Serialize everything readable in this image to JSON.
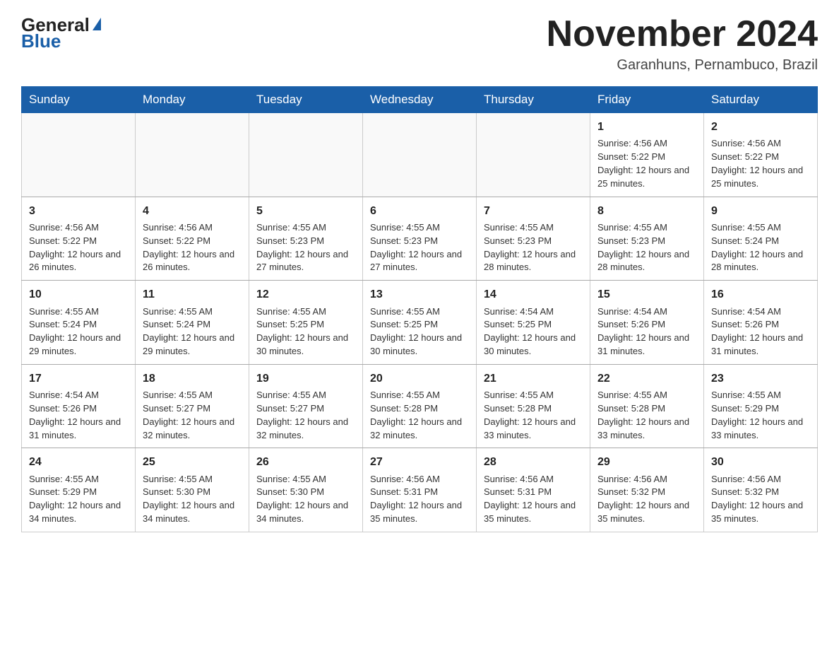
{
  "header": {
    "logo_general": "General",
    "logo_blue": "Blue",
    "month_title": "November 2024",
    "subtitle": "Garanhuns, Pernambuco, Brazil"
  },
  "days_of_week": [
    "Sunday",
    "Monday",
    "Tuesday",
    "Wednesday",
    "Thursday",
    "Friday",
    "Saturday"
  ],
  "weeks": [
    [
      {
        "day": "",
        "info": ""
      },
      {
        "day": "",
        "info": ""
      },
      {
        "day": "",
        "info": ""
      },
      {
        "day": "",
        "info": ""
      },
      {
        "day": "",
        "info": ""
      },
      {
        "day": "1",
        "info": "Sunrise: 4:56 AM\nSunset: 5:22 PM\nDaylight: 12 hours and 25 minutes."
      },
      {
        "day": "2",
        "info": "Sunrise: 4:56 AM\nSunset: 5:22 PM\nDaylight: 12 hours and 25 minutes."
      }
    ],
    [
      {
        "day": "3",
        "info": "Sunrise: 4:56 AM\nSunset: 5:22 PM\nDaylight: 12 hours and 26 minutes."
      },
      {
        "day": "4",
        "info": "Sunrise: 4:56 AM\nSunset: 5:22 PM\nDaylight: 12 hours and 26 minutes."
      },
      {
        "day": "5",
        "info": "Sunrise: 4:55 AM\nSunset: 5:23 PM\nDaylight: 12 hours and 27 minutes."
      },
      {
        "day": "6",
        "info": "Sunrise: 4:55 AM\nSunset: 5:23 PM\nDaylight: 12 hours and 27 minutes."
      },
      {
        "day": "7",
        "info": "Sunrise: 4:55 AM\nSunset: 5:23 PM\nDaylight: 12 hours and 28 minutes."
      },
      {
        "day": "8",
        "info": "Sunrise: 4:55 AM\nSunset: 5:23 PM\nDaylight: 12 hours and 28 minutes."
      },
      {
        "day": "9",
        "info": "Sunrise: 4:55 AM\nSunset: 5:24 PM\nDaylight: 12 hours and 28 minutes."
      }
    ],
    [
      {
        "day": "10",
        "info": "Sunrise: 4:55 AM\nSunset: 5:24 PM\nDaylight: 12 hours and 29 minutes."
      },
      {
        "day": "11",
        "info": "Sunrise: 4:55 AM\nSunset: 5:24 PM\nDaylight: 12 hours and 29 minutes."
      },
      {
        "day": "12",
        "info": "Sunrise: 4:55 AM\nSunset: 5:25 PM\nDaylight: 12 hours and 30 minutes."
      },
      {
        "day": "13",
        "info": "Sunrise: 4:55 AM\nSunset: 5:25 PM\nDaylight: 12 hours and 30 minutes."
      },
      {
        "day": "14",
        "info": "Sunrise: 4:54 AM\nSunset: 5:25 PM\nDaylight: 12 hours and 30 minutes."
      },
      {
        "day": "15",
        "info": "Sunrise: 4:54 AM\nSunset: 5:26 PM\nDaylight: 12 hours and 31 minutes."
      },
      {
        "day": "16",
        "info": "Sunrise: 4:54 AM\nSunset: 5:26 PM\nDaylight: 12 hours and 31 minutes."
      }
    ],
    [
      {
        "day": "17",
        "info": "Sunrise: 4:54 AM\nSunset: 5:26 PM\nDaylight: 12 hours and 31 minutes."
      },
      {
        "day": "18",
        "info": "Sunrise: 4:55 AM\nSunset: 5:27 PM\nDaylight: 12 hours and 32 minutes."
      },
      {
        "day": "19",
        "info": "Sunrise: 4:55 AM\nSunset: 5:27 PM\nDaylight: 12 hours and 32 minutes."
      },
      {
        "day": "20",
        "info": "Sunrise: 4:55 AM\nSunset: 5:28 PM\nDaylight: 12 hours and 32 minutes."
      },
      {
        "day": "21",
        "info": "Sunrise: 4:55 AM\nSunset: 5:28 PM\nDaylight: 12 hours and 33 minutes."
      },
      {
        "day": "22",
        "info": "Sunrise: 4:55 AM\nSunset: 5:28 PM\nDaylight: 12 hours and 33 minutes."
      },
      {
        "day": "23",
        "info": "Sunrise: 4:55 AM\nSunset: 5:29 PM\nDaylight: 12 hours and 33 minutes."
      }
    ],
    [
      {
        "day": "24",
        "info": "Sunrise: 4:55 AM\nSunset: 5:29 PM\nDaylight: 12 hours and 34 minutes."
      },
      {
        "day": "25",
        "info": "Sunrise: 4:55 AM\nSunset: 5:30 PM\nDaylight: 12 hours and 34 minutes."
      },
      {
        "day": "26",
        "info": "Sunrise: 4:55 AM\nSunset: 5:30 PM\nDaylight: 12 hours and 34 minutes."
      },
      {
        "day": "27",
        "info": "Sunrise: 4:56 AM\nSunset: 5:31 PM\nDaylight: 12 hours and 35 minutes."
      },
      {
        "day": "28",
        "info": "Sunrise: 4:56 AM\nSunset: 5:31 PM\nDaylight: 12 hours and 35 minutes."
      },
      {
        "day": "29",
        "info": "Sunrise: 4:56 AM\nSunset: 5:32 PM\nDaylight: 12 hours and 35 minutes."
      },
      {
        "day": "30",
        "info": "Sunrise: 4:56 AM\nSunset: 5:32 PM\nDaylight: 12 hours and 35 minutes."
      }
    ]
  ]
}
